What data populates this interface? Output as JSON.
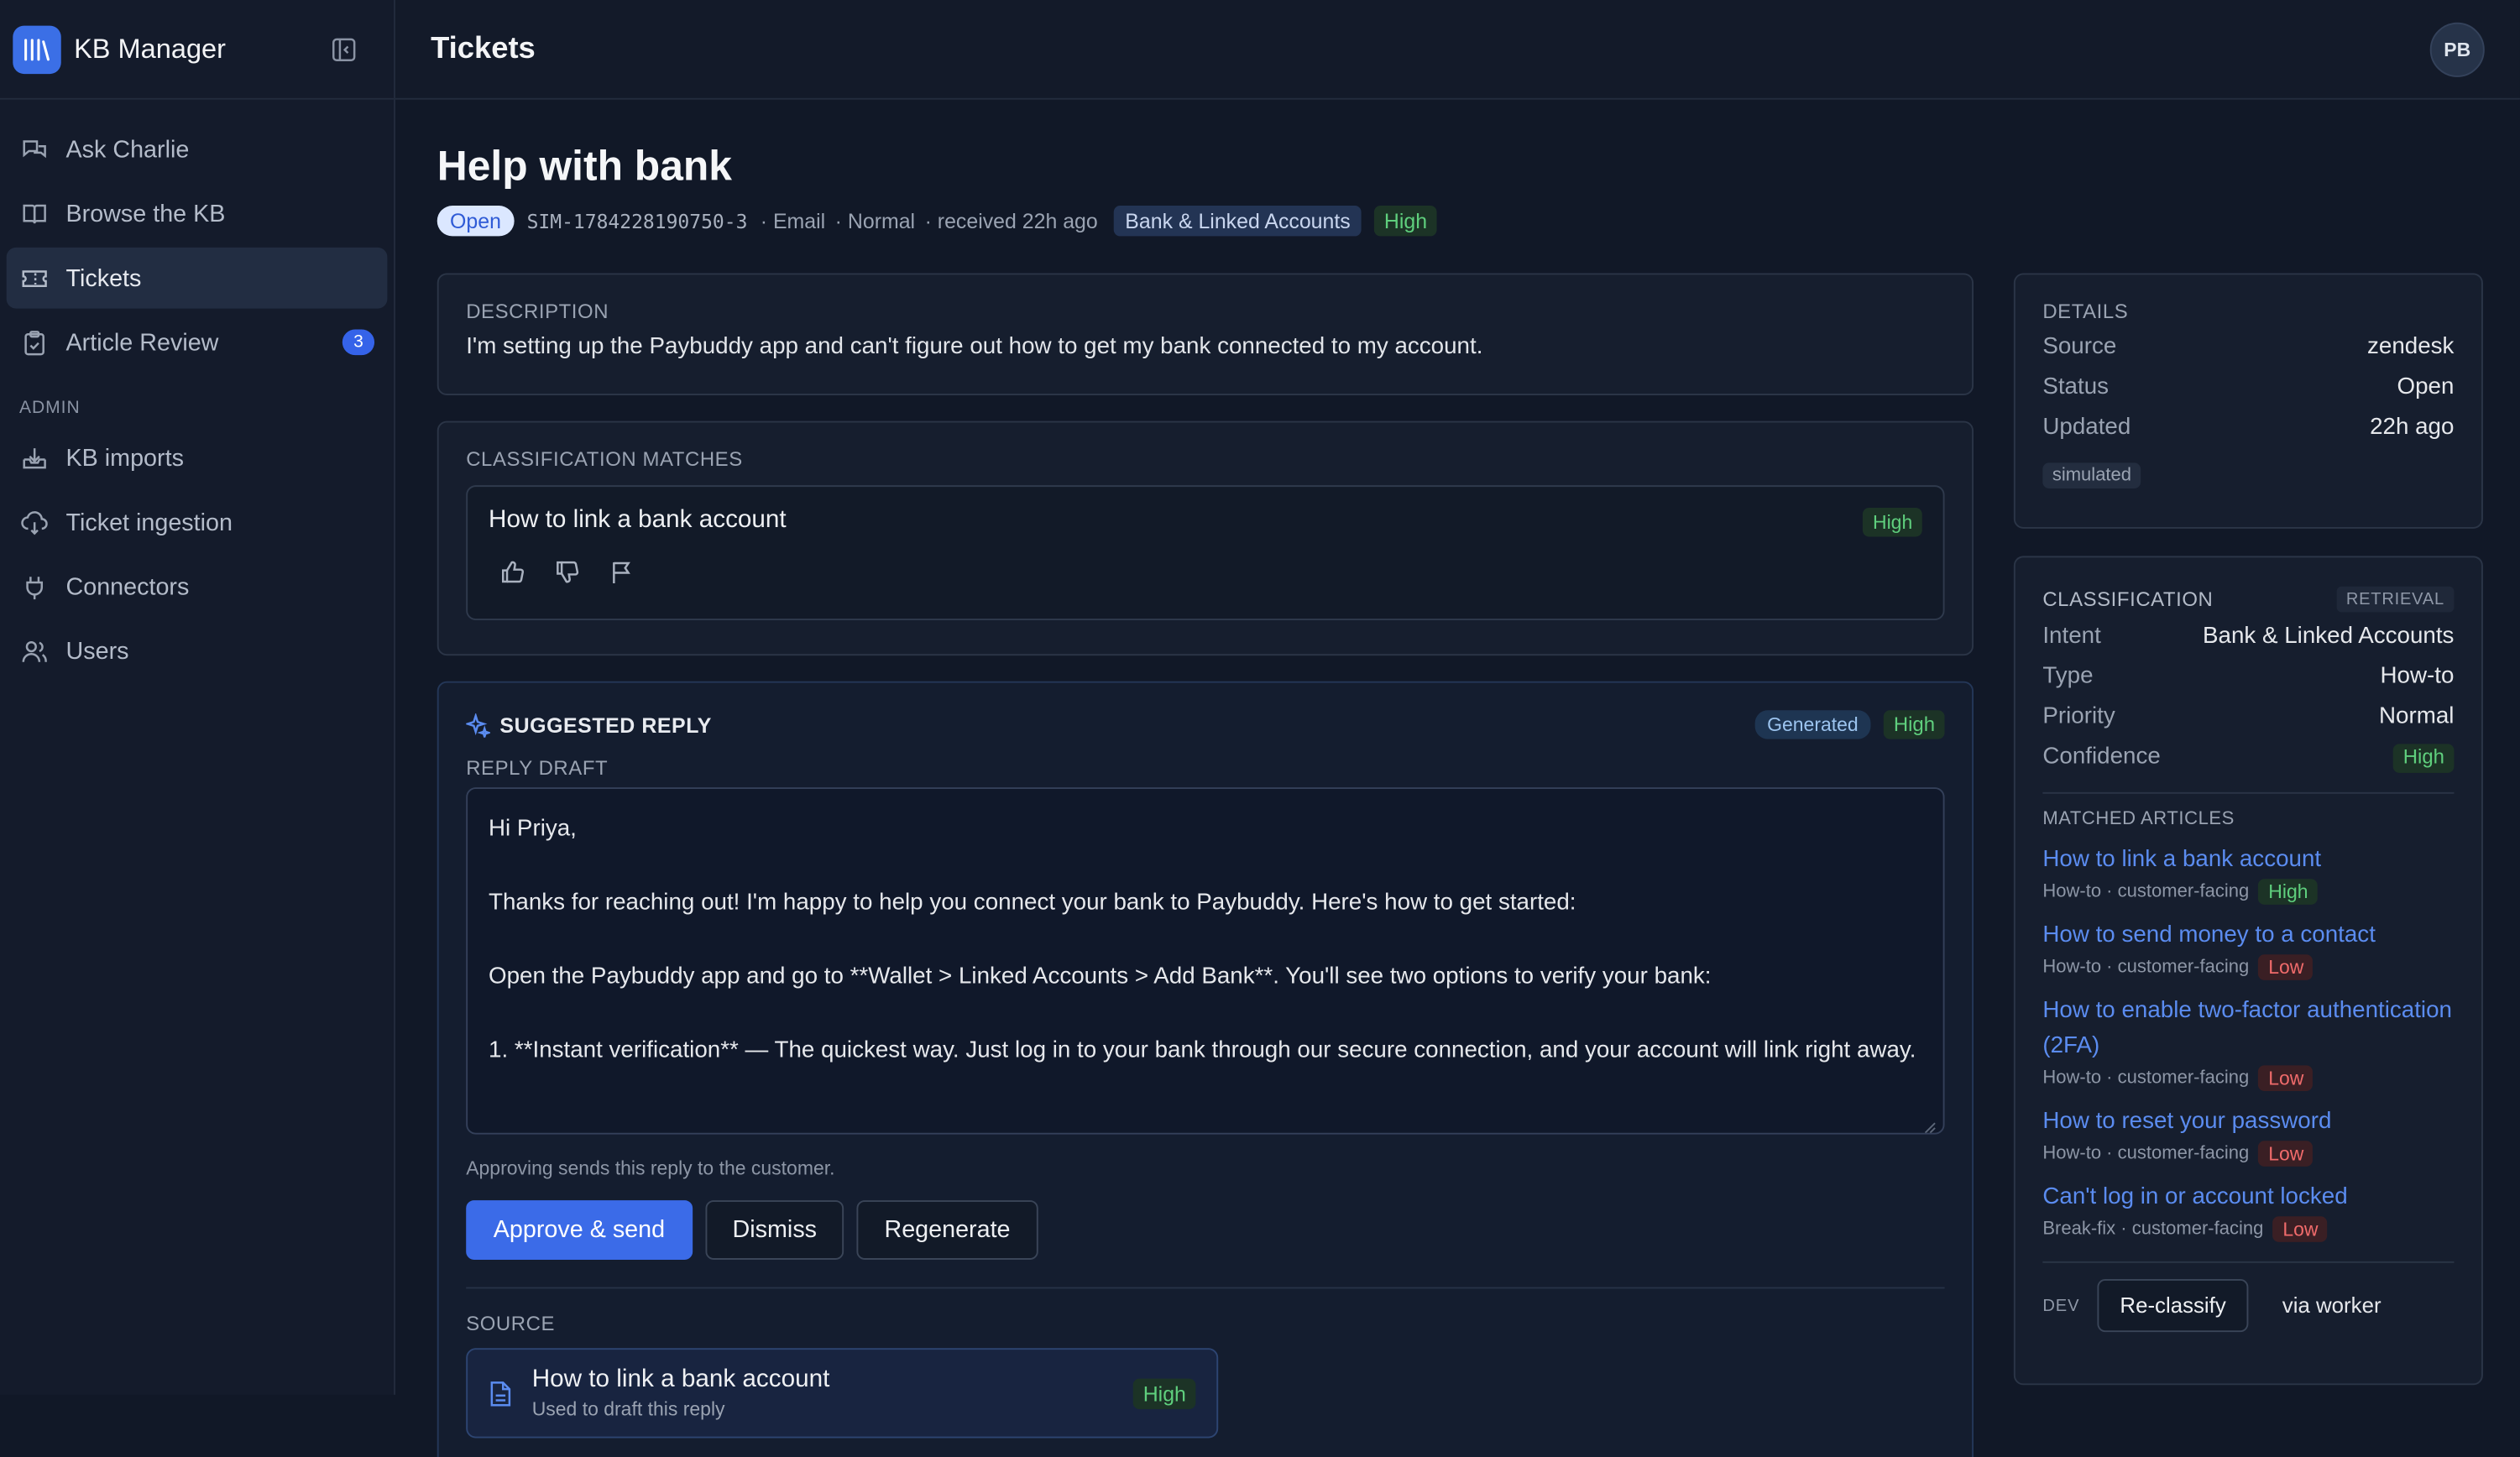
{
  "app": {
    "name": "KB Manager",
    "user_initials": "PB"
  },
  "colors": {
    "accent": "#3b6be8",
    "background": "#111827",
    "link": "#5b8cf0",
    "high": "#5fcf7d",
    "low": "#f06b6b"
  },
  "sidebar": {
    "items": [
      {
        "label": "Ask Charlie",
        "icon": "chat-icon"
      },
      {
        "label": "Browse the KB",
        "icon": "book-icon"
      },
      {
        "label": "Tickets",
        "icon": "ticket-icon",
        "active": true
      },
      {
        "label": "Article Review",
        "icon": "clipboard-icon",
        "badge": "3"
      }
    ],
    "admin_label": "ADMIN",
    "admin_items": [
      {
        "label": "KB imports",
        "icon": "import-icon"
      },
      {
        "label": "Ticket ingestion",
        "icon": "cloud-download-icon"
      },
      {
        "label": "Connectors",
        "icon": "plug-icon"
      },
      {
        "label": "Users",
        "icon": "users-icon"
      }
    ]
  },
  "header": {
    "title": "Tickets"
  },
  "ticket": {
    "title": "Help with bank",
    "status": "Open",
    "id": "SIM-1784228190750-3",
    "channel": "· Email",
    "priority": "· Normal",
    "received": "· received 22h ago",
    "intent": "Bank & Linked Accounts",
    "confidence": "High"
  },
  "description": {
    "label": "DESCRIPTION",
    "text": "I'm setting up the Paybuddy app and can't figure out how to get my bank connected to my account."
  },
  "classification_matches": {
    "label": "CLASSIFICATION MATCHES",
    "match_title": "How to link a bank account",
    "match_confidence": "High"
  },
  "suggested_reply": {
    "label": "SUGGESTED REPLY",
    "generated": "Generated",
    "confidence": "High",
    "draft_label": "REPLY DRAFT",
    "draft_lines": [
      "Hi Priya,",
      "Thanks for reaching out! I'm happy to help you connect your bank to Paybuddy. Here's how to get started:",
      "Open the Paybuddy app and go to **Wallet > Linked Accounts > Add Bank**. You'll see two options to verify your bank:",
      "1. **Instant verification** — The quickest way. Just log in to your bank through our secure connection, and your account will link right away."
    ],
    "hint": "Approving sends this reply to the customer.",
    "approve": "Approve & send",
    "dismiss": "Dismiss",
    "regenerate": "Regenerate",
    "source_label": "SOURCE",
    "source_title": "How to link a bank account",
    "source_sub": "Used to draft this reply",
    "source_confidence": "High"
  },
  "details": {
    "label": "DETAILS",
    "rows": [
      {
        "k": "Source",
        "v": "zendesk"
      },
      {
        "k": "Status",
        "v": "Open"
      },
      {
        "k": "Updated",
        "v": "22h ago"
      }
    ],
    "tag": "simulated"
  },
  "classification": {
    "label": "CLASSIFICATION",
    "mode": "RETRIEVAL",
    "rows": [
      {
        "k": "Intent",
        "v": "Bank & Linked Accounts"
      },
      {
        "k": "Type",
        "v": "How-to"
      },
      {
        "k": "Priority",
        "v": "Normal"
      }
    ],
    "confidence_label": "Confidence",
    "confidence_value": "High",
    "matched_label": "MATCHED ARTICLES",
    "articles": [
      {
        "title": "How to link a bank account",
        "meta": "How-to · customer-facing",
        "score": "High"
      },
      {
        "title": "How to send money to a contact",
        "meta": "How-to · customer-facing",
        "score": "Low"
      },
      {
        "title": "How to enable two-factor authentication (2FA)",
        "meta": "How-to · customer-facing",
        "score": "Low"
      },
      {
        "title": "How to reset your password",
        "meta": "How-to · customer-facing",
        "score": "Low"
      },
      {
        "title": "Can't log in or account locked",
        "meta": "Break-fix · customer-facing",
        "score": "Low"
      }
    ],
    "dev_label": "DEV",
    "reclassify": "Re-classify",
    "via_worker": "via worker"
  }
}
